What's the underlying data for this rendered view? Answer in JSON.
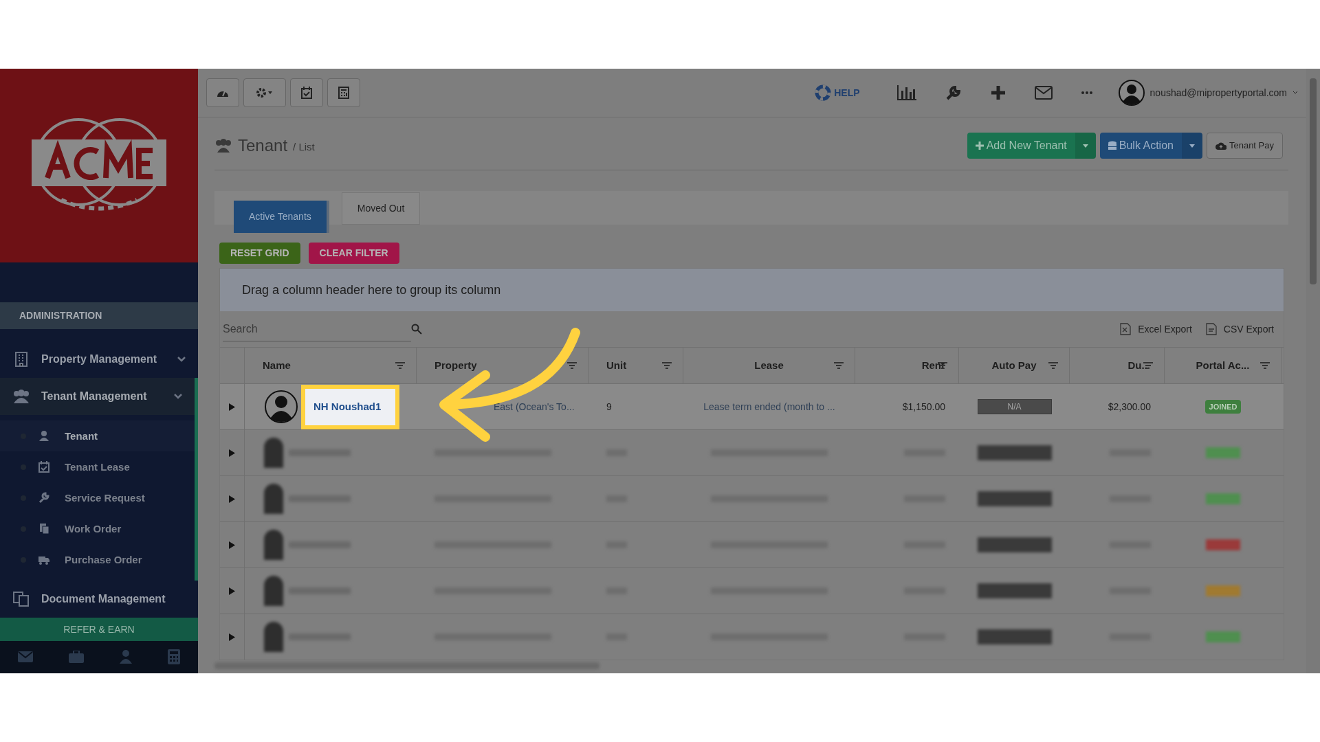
{
  "top_nav": {
    "help": "HELP",
    "user": "noushad@mipropertyportal.com"
  },
  "sidebar": {
    "section": "ADMINISTRATION",
    "items": [
      {
        "label": "Property Management",
        "selected": false
      },
      {
        "label": "Tenant Management",
        "selected": true,
        "children": [
          {
            "label": "Tenant",
            "selected": true
          },
          {
            "label": "Tenant Lease",
            "selected": false
          },
          {
            "label": "Service Request",
            "selected": false
          },
          {
            "label": "Work Order",
            "selected": false
          },
          {
            "label": "Purchase Order",
            "selected": false
          }
        ]
      },
      {
        "label": "Document Management",
        "selected": false
      }
    ],
    "refer": "REFER & EARN"
  },
  "page_header": {
    "title": "Tenant",
    "crumb": "/ List",
    "actions": [
      "Add New Tenant",
      "Bulk Action",
      "Tenant Pay"
    ]
  },
  "tabs": [
    {
      "label": "Active Tenants",
      "selected": true
    },
    {
      "label": "Moved Out",
      "selected": false
    }
  ],
  "grid_buttons": [
    {
      "label": "RESET GRID",
      "color": "#3b6418"
    },
    {
      "label": "CLEAR FILTER",
      "color": "#a11548"
    }
  ],
  "grid": {
    "group_hint": "Drag a column header here to group its column",
    "search": {
      "placeholder": "Search"
    },
    "exports": [
      "Excel Export",
      "CSV Export"
    ],
    "columns": [
      "Name",
      "Property",
      "Unit",
      "Lease",
      "Rent",
      "Auto Pay",
      "Du...",
      "Portal Ac..."
    ],
    "rows": [
      {
        "kind": "clear",
        "highlighted": true,
        "name": "NH Noushad1",
        "property": "East (Ocean's To...",
        "unit": "9",
        "lease": "Lease term ended (month to ...",
        "rent": "$1,150.00",
        "auto_pay": "N/A",
        "due": "$2,300.00",
        "portal": "JOINED"
      },
      {
        "kind": "blurred",
        "color": "#4f8f4f"
      },
      {
        "kind": "blurred",
        "color": "#4f8f4f"
      },
      {
        "kind": "blurred",
        "color": "#9a3a3a"
      },
      {
        "kind": "blurred",
        "color": "#a07a30"
      },
      {
        "kind": "blurred",
        "color": "#4f8f4f"
      }
    ]
  }
}
